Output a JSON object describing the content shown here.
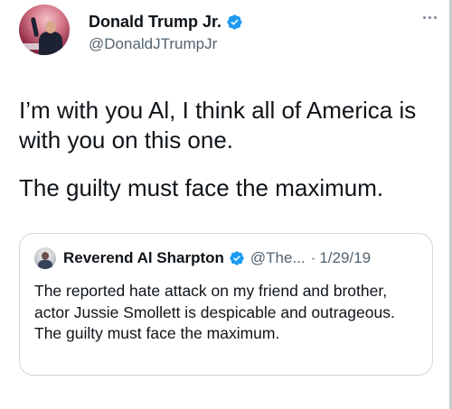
{
  "author": {
    "display_name": "Donald Trump Jr.",
    "handle": "@DonaldJTrumpJr",
    "verified": true
  },
  "tweet": {
    "paragraph_1": "I’m with you Al, I think all of America is with you on this one.",
    "paragraph_2": "The guilty must face the maximum."
  },
  "quoted_tweet": {
    "display_name": "Reverend Al Sharpton",
    "handle": "@The...",
    "separator": "·",
    "date": "1/29/19",
    "text": "The reported hate attack on my friend and brother, actor Jussie Smollett is despicable and outrageous. The guilty must face the maximum."
  },
  "icons": {
    "more": "more-options-icon",
    "verified": "verified-badge-icon"
  },
  "colors": {
    "verified_blue": "#1d9bf0",
    "secondary_text": "#536471",
    "primary_text": "#0f1419",
    "quote_border": "#cfd9de"
  }
}
